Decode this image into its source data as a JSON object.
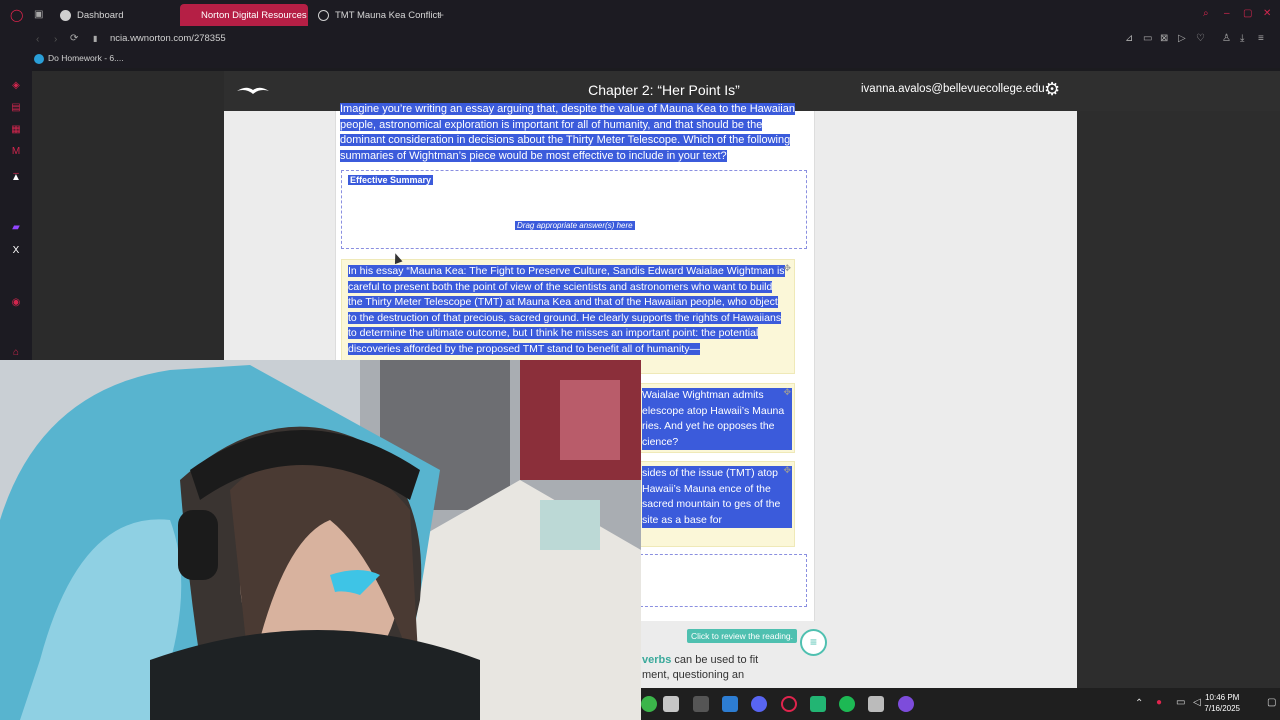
{
  "browser": {
    "tabs": [
      {
        "label": "Dashboard",
        "active": false
      },
      {
        "label": "Norton Digital Resources",
        "active": true
      },
      {
        "label": "TMT Mauna Kea Conflict",
        "active": false
      }
    ],
    "new_tab": "+",
    "url": "ncia.wwnorton.com/278355",
    "bookmark": "Do Homework - 6...."
  },
  "app": {
    "chapter_title": "Chapter 2: “Her Point Is”",
    "user_email": "ivanna.avalos@bellevuecollege.edu"
  },
  "question": {
    "prompt": "Imagine you’re writing an essay arguing that, despite the value of Mauna Kea to the Hawaiian people, astronomical exploration is important for all of humanity, and that should be the dominant consideration in decisions about the Thirty Meter Telescope. Which of the following summaries of Wightman’s piece would be most effective to include in your text?",
    "drop_label": "Effective Summary",
    "drop_hint": "Drag appropriate answer(s) here",
    "answers": [
      "In his essay “Mauna Kea: The Fight to Preserve Culture, Sandis Edward Waialae Wightman is careful to present both the point of view of the scientists and astronomers who want to build the Thirty Meter Telescope (TMT) at Mauna Kea and that of the Hawaiian people, who object to the destruction of that precious, sacred ground. He clearly supports the rights of Hawaiians to determine the ultimate outcome, but I think he misses an important point: the potential discoveries afforded by the proposed TMT stand to benefit all of humanity—",
      "Waialae Wightman admits elescope atop Hawaii’s Mauna ries. And yet he opposes the cience?",
      "sides of the issue (TMT) atop Hawaii’s Mauna ence of the sacred mountain to ges of the site as a base for"
    ],
    "review_link": "Click to review the reading.",
    "footer_keyword": "verbs",
    "footer_text_1": " can be used to fit",
    "footer_text_2": "ment, questioning an"
  },
  "taskbar": {
    "time": "10:46 PM",
    "date": "7/16/2025"
  },
  "colors": {
    "accent": "#b51f45",
    "selection": "#3b5bdb",
    "teal": "#4fc0b0"
  }
}
